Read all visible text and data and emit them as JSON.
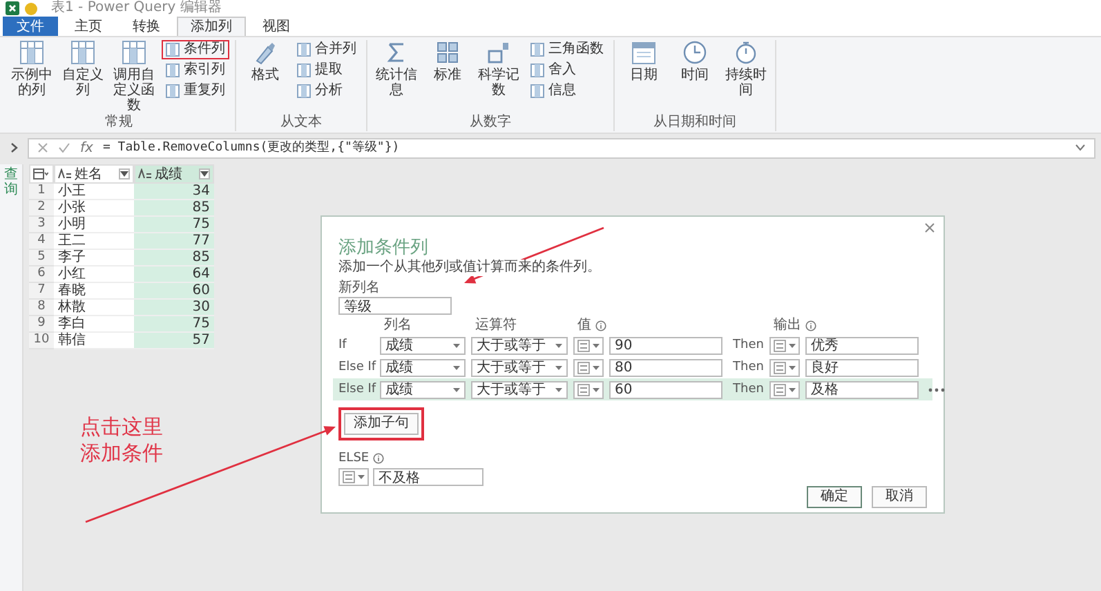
{
  "window": {
    "title": "表1 - Power Query 编辑器"
  },
  "tabs": [
    {
      "label": "文件",
      "kind": "file",
      "selected": false
    },
    {
      "label": "主页",
      "kind": "tab",
      "selected": false
    },
    {
      "label": "转换",
      "kind": "tab",
      "selected": false
    },
    {
      "label": "添加列",
      "kind": "tab",
      "selected": true
    },
    {
      "label": "视图",
      "kind": "tab",
      "selected": false
    }
  ],
  "ribbon": {
    "groups": [
      {
        "label": "常规",
        "large": [
          {
            "label": "示例中的列"
          },
          {
            "label": "自定义列"
          },
          {
            "label": "调用自定义函数"
          }
        ],
        "small": [
          {
            "label": "条件列",
            "callout": true
          },
          {
            "label": "索引列",
            "callout": false
          },
          {
            "label": "重复列",
            "callout": false
          }
        ]
      },
      {
        "label": "从文本",
        "large": [
          {
            "label": "格式"
          }
        ],
        "small": [
          {
            "label": "合并列",
            "callout": false
          },
          {
            "label": "提取",
            "callout": false
          },
          {
            "label": "分析",
            "callout": false
          }
        ]
      },
      {
        "label": "从数字",
        "large": [
          {
            "label": "统计信息"
          },
          {
            "label": "标准"
          },
          {
            "label": "科学记数"
          }
        ],
        "small": [
          {
            "label": "三角函数",
            "callout": false
          },
          {
            "label": "舍入",
            "callout": false
          },
          {
            "label": "信息",
            "callout": false
          }
        ]
      },
      {
        "label": "从日期和时间",
        "large": [
          {
            "label": "日期"
          },
          {
            "label": "时间"
          },
          {
            "label": "持续时间"
          }
        ]
      }
    ]
  },
  "formula_bar": {
    "fx_label": "fx",
    "formula": "= Table.RemoveColumns(更改的类型,{\"等级\"})"
  },
  "queries_pane": {
    "label": "查询"
  },
  "table": {
    "columns": [
      {
        "name": "姓名",
        "selected": false
      },
      {
        "name": "成绩",
        "selected": true
      }
    ],
    "rows": [
      {
        "index": "1",
        "cells": [
          "小王",
          "34"
        ]
      },
      {
        "index": "2",
        "cells": [
          "小张",
          "85"
        ]
      },
      {
        "index": "3",
        "cells": [
          "小明",
          "75"
        ]
      },
      {
        "index": "4",
        "cells": [
          "王二",
          "77"
        ]
      },
      {
        "index": "5",
        "cells": [
          "李子",
          "85"
        ]
      },
      {
        "index": "6",
        "cells": [
          "小红",
          "64"
        ]
      },
      {
        "index": "7",
        "cells": [
          "春晓",
          "60"
        ]
      },
      {
        "index": "8",
        "cells": [
          "林散",
          "30"
        ]
      },
      {
        "index": "9",
        "cells": [
          "李白",
          "75"
        ]
      },
      {
        "index": "10",
        "cells": [
          "韩信",
          "57"
        ]
      }
    ]
  },
  "dialog": {
    "title": "添加条件列",
    "description": "添加一个从其他列或值计算而来的条件列。",
    "new_column_label": "新列名",
    "new_column_value": "等级",
    "headers": {
      "column": "列名",
      "operator": "运算符",
      "value": "值",
      "output": "输出"
    },
    "clauses": [
      {
        "keyword": "If",
        "column": "成绩",
        "operator": "大于或等于",
        "value": "90",
        "then": "Then",
        "output": "优秀",
        "selected": false
      },
      {
        "keyword": "Else If",
        "column": "成绩",
        "operator": "大于或等于",
        "value": "80",
        "then": "Then",
        "output": "良好",
        "selected": false
      },
      {
        "keyword": "Else If",
        "column": "成绩",
        "operator": "大于或等于",
        "value": "60",
        "then": "Then",
        "output": "及格",
        "selected": true
      }
    ],
    "add_clause": {
      "label": "添加子句",
      "callout": true
    },
    "else_label": "ELSE",
    "else_value": "不及格",
    "buttons": [
      {
        "label": "确定",
        "primary": true
      },
      {
        "label": "取消",
        "primary": false
      }
    ]
  },
  "annotation": {
    "lines": [
      "点击这里",
      "添加条件"
    ]
  }
}
